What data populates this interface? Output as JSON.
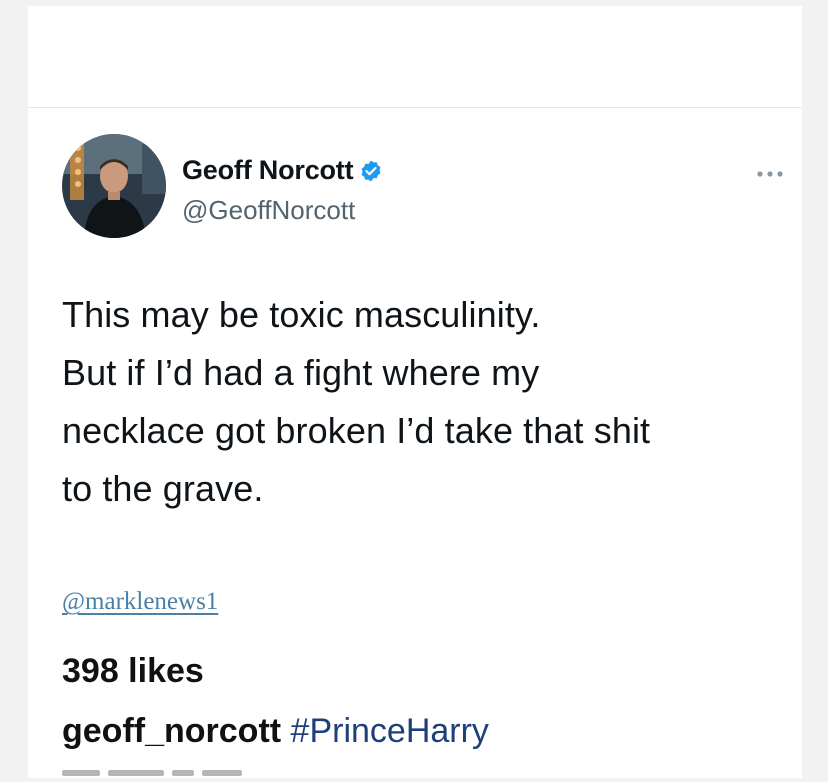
{
  "tweet": {
    "display_name": "Geoff Norcott",
    "handle": "@GeoffNorcott",
    "verified": true,
    "lines": [
      "This may be toxic masculinity.",
      "But if I’d had a fight where my",
      "necklace got broken I’d take that shit",
      "to the grave."
    ]
  },
  "watermark": "@marklenews1",
  "post": {
    "likes": "398 likes",
    "caption_user": "geoff_norcott",
    "caption_tag": "#PrinceHarry"
  },
  "icons": {
    "verified": "verified-badge-icon",
    "more": "more-options-icon"
  },
  "colors": {
    "verified": "#1d9bf0",
    "handle": "#536471",
    "hashtag": "#1f3f7a",
    "watermark": "#4a7fa6"
  }
}
